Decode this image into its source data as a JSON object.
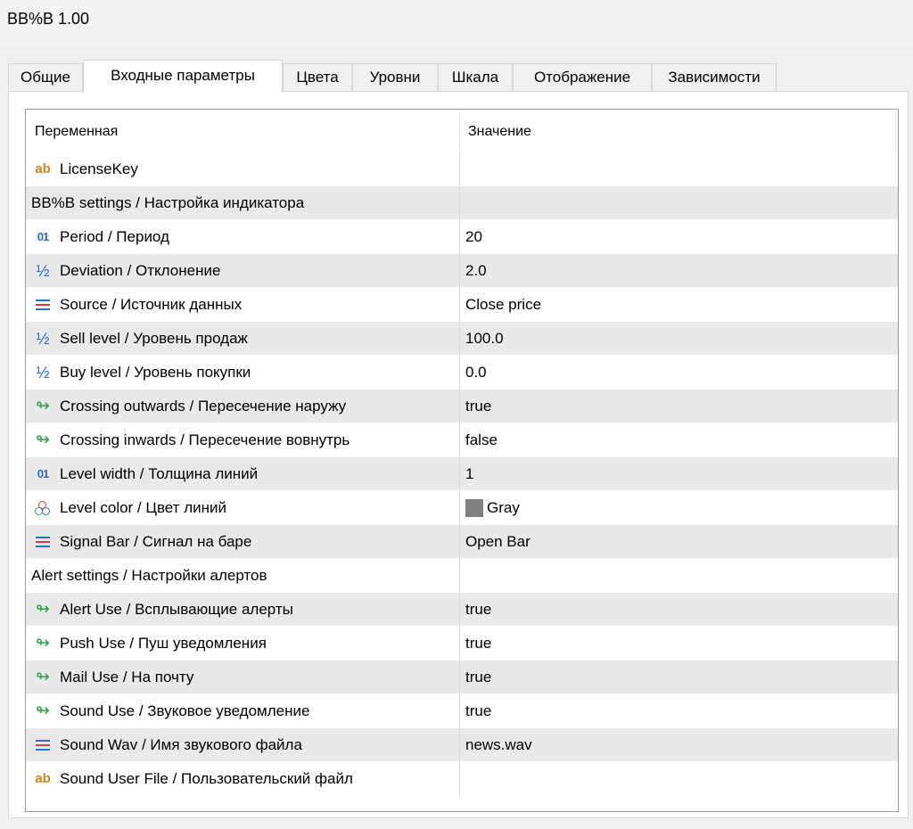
{
  "window": {
    "title": "BB%B 1.00"
  },
  "tabs": [
    {
      "label": "Общие",
      "active": false
    },
    {
      "label": "Входные параметры",
      "active": true
    },
    {
      "label": "Цвета",
      "active": false
    },
    {
      "label": "Уровни",
      "active": false
    },
    {
      "label": "Шкала",
      "active": false
    },
    {
      "label": "Отображение",
      "active": false
    },
    {
      "label": "Зависимости",
      "active": false
    }
  ],
  "grid": {
    "columns": [
      "Переменная",
      "Значение"
    ],
    "rows": [
      {
        "kind": "param",
        "icon": "string-icon",
        "name": "LicenseKey",
        "value": ""
      },
      {
        "kind": "group",
        "name": "BB%B settings / Настройка индикатора",
        "value": ""
      },
      {
        "kind": "param",
        "icon": "integer-icon",
        "name": "Period / Период",
        "value": "20"
      },
      {
        "kind": "param",
        "icon": "double-icon",
        "name": "Deviation / Отклонение",
        "value": "2.0"
      },
      {
        "kind": "param",
        "icon": "enum-icon",
        "name": "Source / Источник данных",
        "value": "Close price"
      },
      {
        "kind": "param",
        "icon": "double-icon",
        "name": "Sell level / Уровень продаж",
        "value": "100.0"
      },
      {
        "kind": "param",
        "icon": "double-icon",
        "name": "Buy level / Уровень покупки",
        "value": "0.0"
      },
      {
        "kind": "param",
        "icon": "bool-icon",
        "name": "Crossing outwards / Пересечение наружу",
        "value": "true"
      },
      {
        "kind": "param",
        "icon": "bool-icon",
        "name": "Crossing inwards / Пересечение вовнутрь",
        "value": "false"
      },
      {
        "kind": "param",
        "icon": "integer-icon",
        "name": "Level width / Толщина линий",
        "value": "1"
      },
      {
        "kind": "param",
        "icon": "color-icon",
        "name": "Level color / Цвет линий",
        "value": "Gray",
        "swatch": "#808080"
      },
      {
        "kind": "param",
        "icon": "enum-icon",
        "name": "Signal Bar / Сигнал на баре",
        "value": "Open Bar"
      },
      {
        "kind": "group",
        "name": "Alert settings / Настройки алертов",
        "value": ""
      },
      {
        "kind": "param",
        "icon": "bool-icon",
        "name": "Alert Use / Всплывающие алерты",
        "value": "true"
      },
      {
        "kind": "param",
        "icon": "bool-icon",
        "name": "Push Use / Пуш уведомления",
        "value": "true"
      },
      {
        "kind": "param",
        "icon": "bool-icon",
        "name": "Mail Use / На почту",
        "value": "true"
      },
      {
        "kind": "param",
        "icon": "bool-icon",
        "name": "Sound Use / Звуковое уведомление",
        "value": "true"
      },
      {
        "kind": "param",
        "icon": "enum-icon",
        "name": "Sound Wav / Имя звукового файла",
        "value": "news.wav"
      },
      {
        "kind": "param",
        "icon": "string-icon",
        "name": "Sound User File / Пользовательский файл",
        "value": ""
      }
    ]
  },
  "colors": {
    "string_icon": "#c8891a",
    "numeric_icon": "#2b6fc2",
    "bool_icon": "#2ea44f",
    "alt_row": "#e9e9e9"
  }
}
